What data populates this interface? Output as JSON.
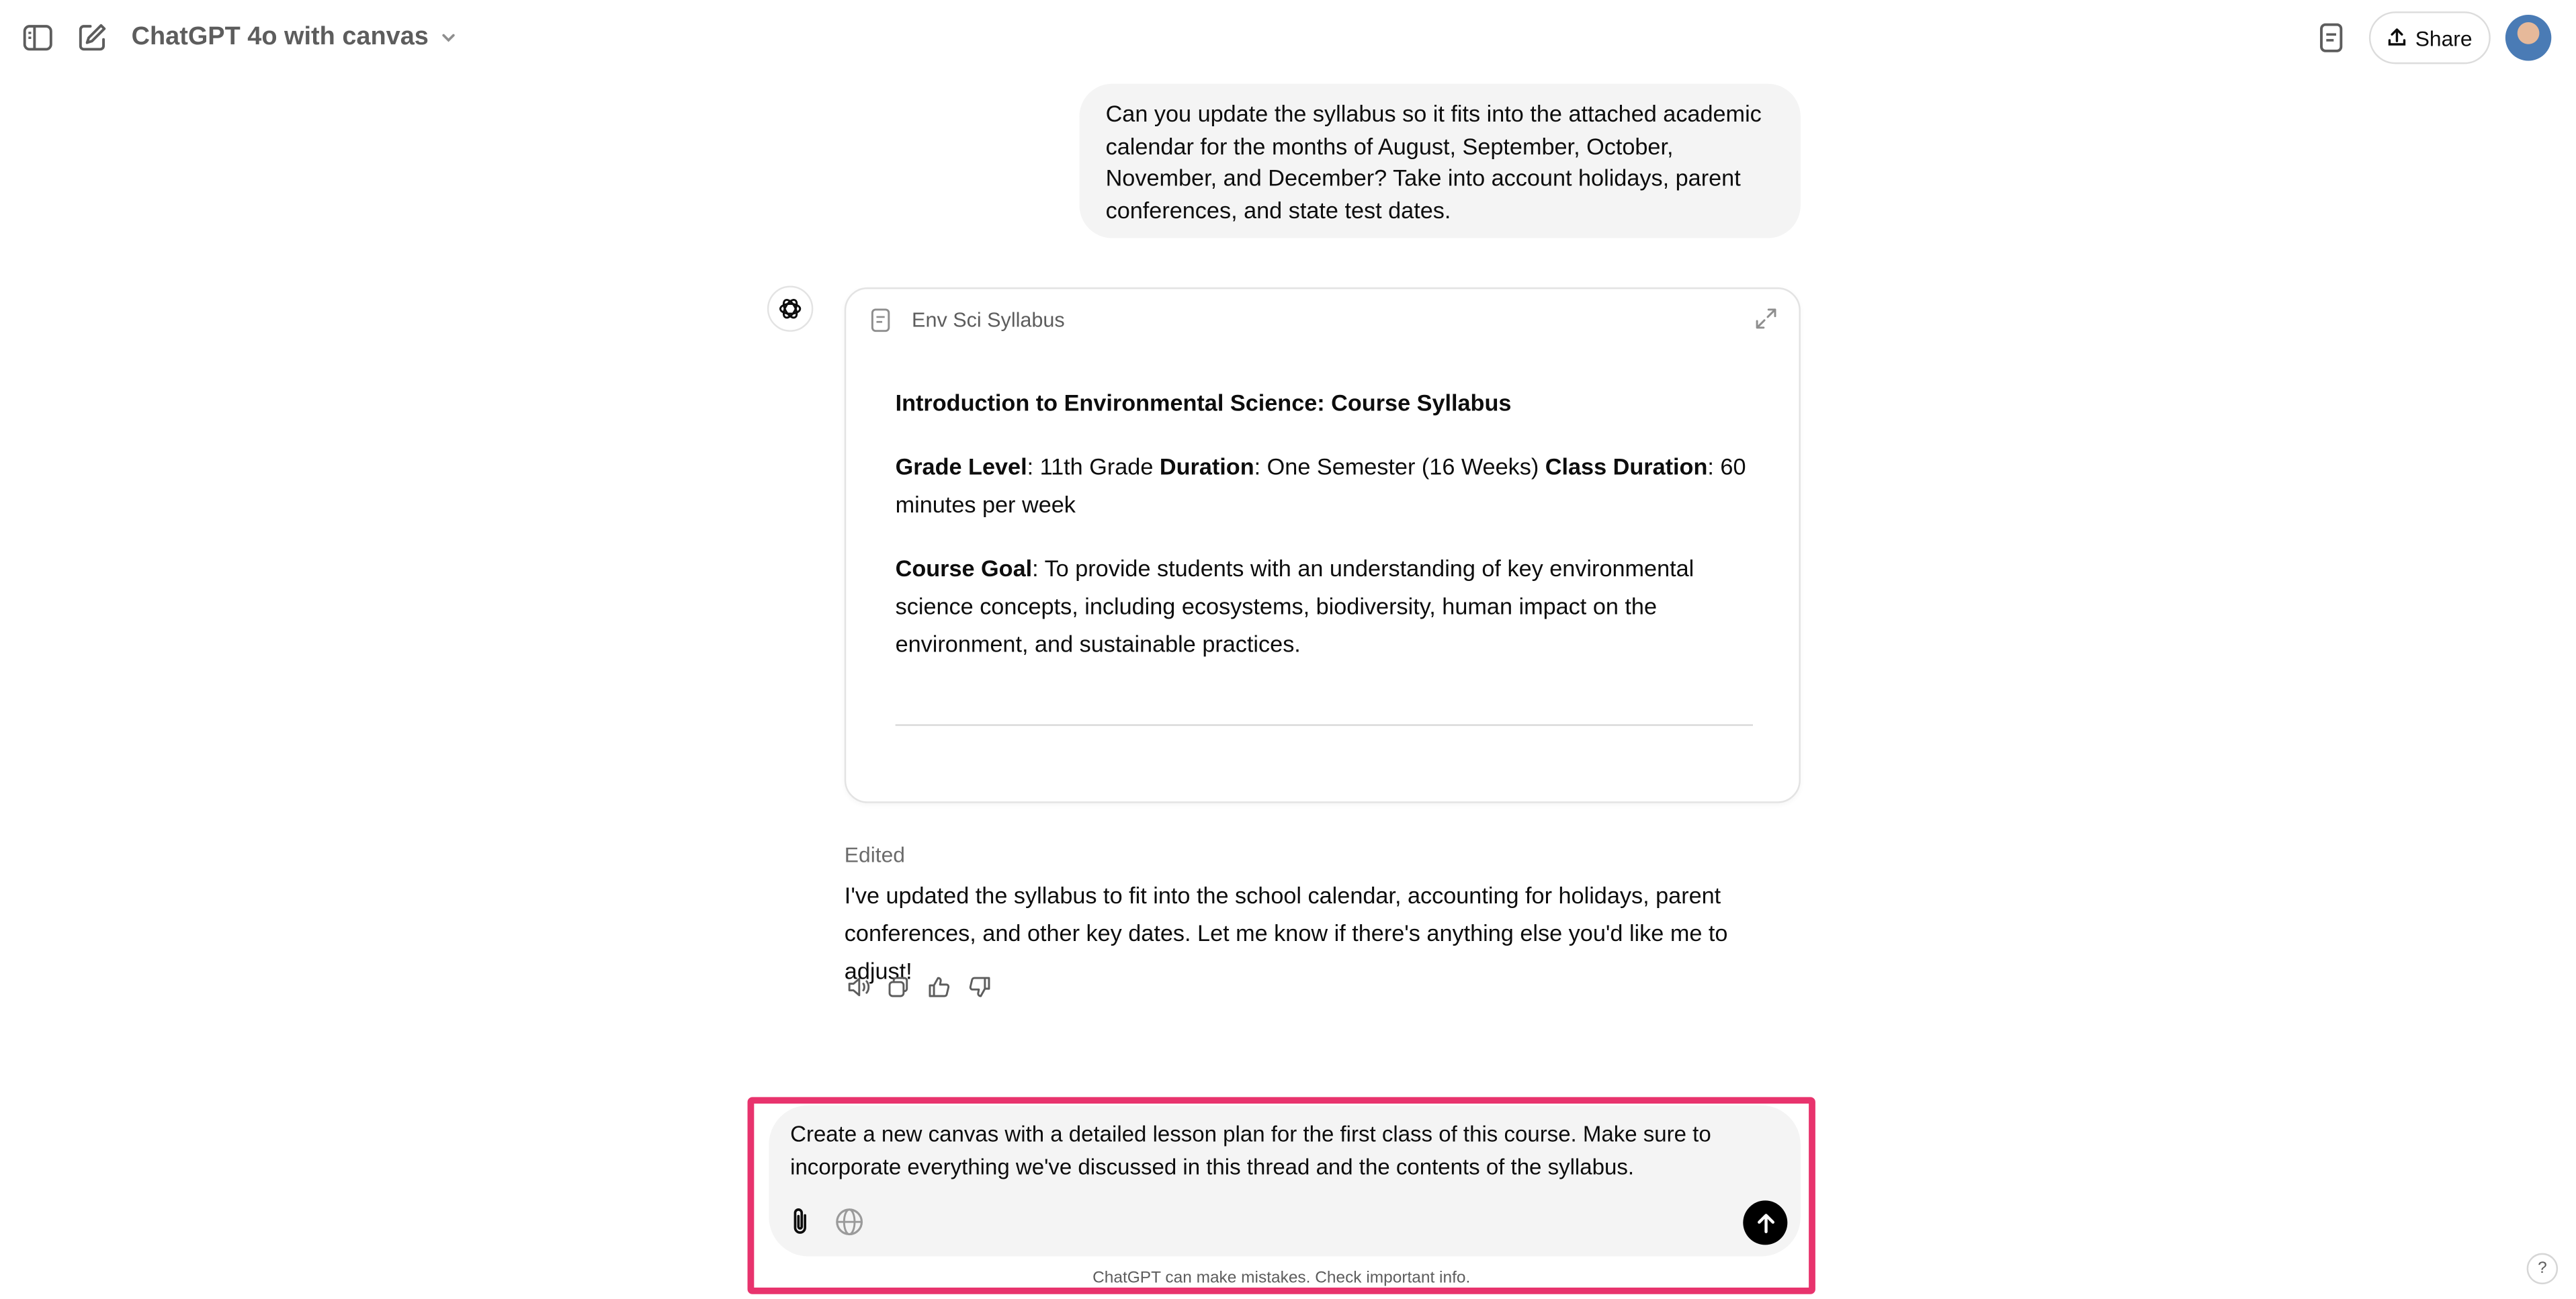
{
  "header": {
    "model_title": "ChatGPT 4o with canvas",
    "share_label": "Share"
  },
  "icons": {
    "sidebar_toggle": "sidebar-toggle-icon",
    "new_chat": "compose-icon",
    "canvas": "document-icon",
    "share": "upload-icon",
    "expand": "expand-icon",
    "read_aloud": "speaker-icon",
    "copy": "copy-icon",
    "like": "thumbs-up-icon",
    "dislike": "thumbs-down-icon",
    "attach": "paperclip-icon",
    "search_web": "globe-icon",
    "send": "arrow-up-icon"
  },
  "user_message": "Can you update the syllabus so it fits into the attached academic calendar for the months of August, September, October, November, and December? Take into account holidays, parent conferences, and state test dates.",
  "canvas_card": {
    "title": "Env Sci Syllabus",
    "heading": "Introduction to Environmental Science: Course Syllabus",
    "grade_level_label": "Grade Level",
    "grade_level_value": ": 11th Grade ",
    "duration_label": "Duration",
    "duration_value": ": One Semester (16 Weeks) ",
    "class_duration_label": "Class Duration",
    "class_duration_value": ": 60 minutes per week",
    "course_goal_label": "Course Goal",
    "course_goal_value": ": To provide students with an understanding of key environmental science concepts, including ecosystems, biodiversity, human impact on the environment, and sustainable practices."
  },
  "response": {
    "edited_label": "Edited",
    "text": "I've updated the syllabus to fit into the school calendar, accounting for holidays, parent conferences, and other key dates. Let me know if there's anything else you'd like me to adjust!"
  },
  "composer": {
    "text": "Create a new canvas with a detailed lesson plan for the first class of this course. Make sure to incorporate everything we've discussed in this thread and the contents of the syllabus."
  },
  "footer": {
    "disclaimer": "ChatGPT can make mistakes. Check important info.",
    "help": "?"
  },
  "colors": {
    "highlight": "#e8336d",
    "bubble": "#f4f4f4",
    "send": "#000000"
  }
}
